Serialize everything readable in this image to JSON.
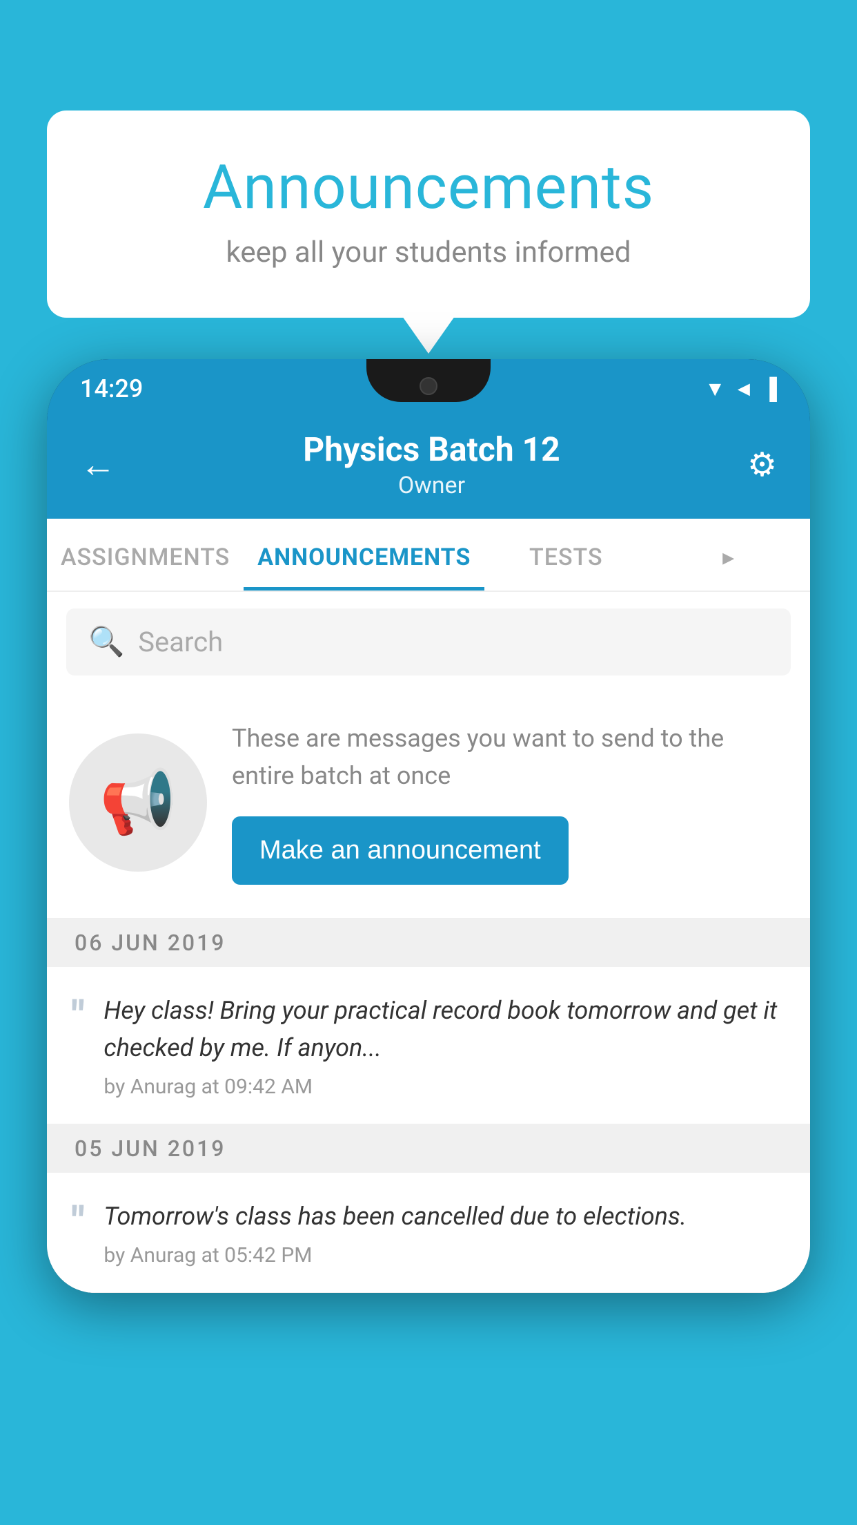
{
  "background_color": "#29b6d9",
  "speech_bubble": {
    "title": "Announcements",
    "subtitle": "keep all your students informed"
  },
  "phone": {
    "status_bar": {
      "time": "14:29",
      "icons": "▼◄▐"
    },
    "header": {
      "back_label": "←",
      "title": "Physics Batch 12",
      "subtitle": "Owner",
      "settings_label": "⚙"
    },
    "tabs": [
      {
        "label": "ASSIGNMENTS",
        "active": false
      },
      {
        "label": "ANNOUNCEMENTS",
        "active": true
      },
      {
        "label": "TESTS",
        "active": false
      },
      {
        "label": "▸",
        "active": false
      }
    ],
    "search": {
      "placeholder": "Search"
    },
    "empty_state": {
      "description": "These are messages you want to send to the entire batch at once",
      "cta_label": "Make an announcement"
    },
    "announcements": [
      {
        "date": "06  JUN  2019",
        "items": [
          {
            "text": "Hey class! Bring your practical record book tomorrow and get it checked by me. If anyon...",
            "meta": "by Anurag at 09:42 AM"
          }
        ]
      },
      {
        "date": "05  JUN  2019",
        "items": [
          {
            "text": "Tomorrow's class has been cancelled due to elections.",
            "meta": "by Anurag at 05:42 PM"
          }
        ]
      }
    ]
  }
}
